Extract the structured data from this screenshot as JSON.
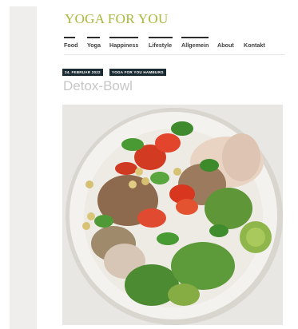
{
  "site": {
    "title": "YOGA FOR YOU"
  },
  "nav": {
    "items": [
      {
        "label": "Food"
      },
      {
        "label": "Yoga"
      },
      {
        "label": "Happiness"
      },
      {
        "label": "Lifestyle"
      },
      {
        "label": "Allgemein"
      },
      {
        "label": "About"
      },
      {
        "label": "Kontakt"
      }
    ]
  },
  "post": {
    "date": "24. FEBRUAR 2022",
    "category": "YOGA FOR YOU HAMBURG",
    "title": "Detox-Bowl"
  },
  "colors": {
    "accent": "#a8b83a",
    "meta_bg": "#1b2b33",
    "nav_text": "#3e3e3e",
    "title_text": "#c7c7c7"
  }
}
